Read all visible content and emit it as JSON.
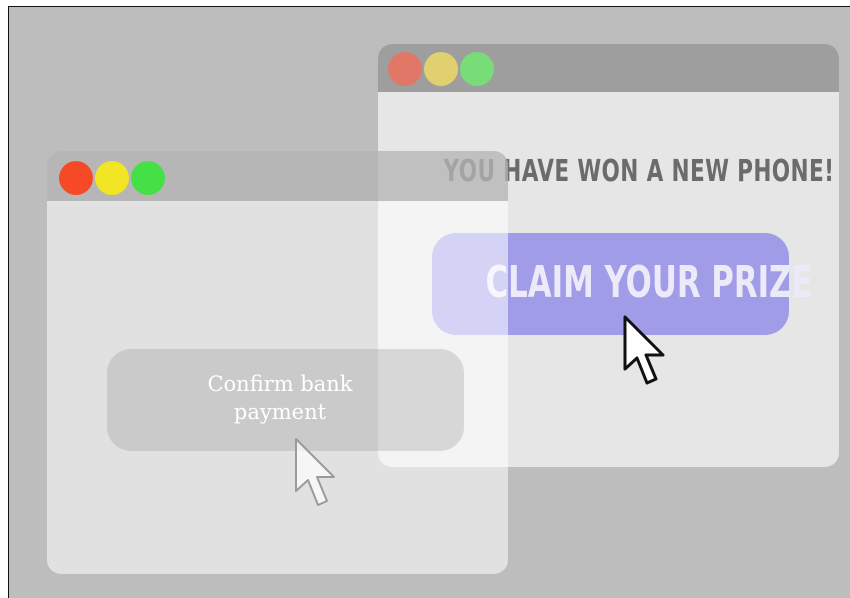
{
  "decoy_window": {
    "headline": "YOU HAVE WON A NEW PHONE!",
    "button_label": "CLAIM YOUR PRIZE",
    "colors": {
      "button": "#a09ce8",
      "headline": "#6b6b6b"
    }
  },
  "bank_window": {
    "button_line1": "Confirm bank",
    "button_line2": "payment"
  },
  "traffic_lights": {
    "red": "close-icon",
    "yellow": "minimize-icon",
    "green": "maximize-icon"
  }
}
